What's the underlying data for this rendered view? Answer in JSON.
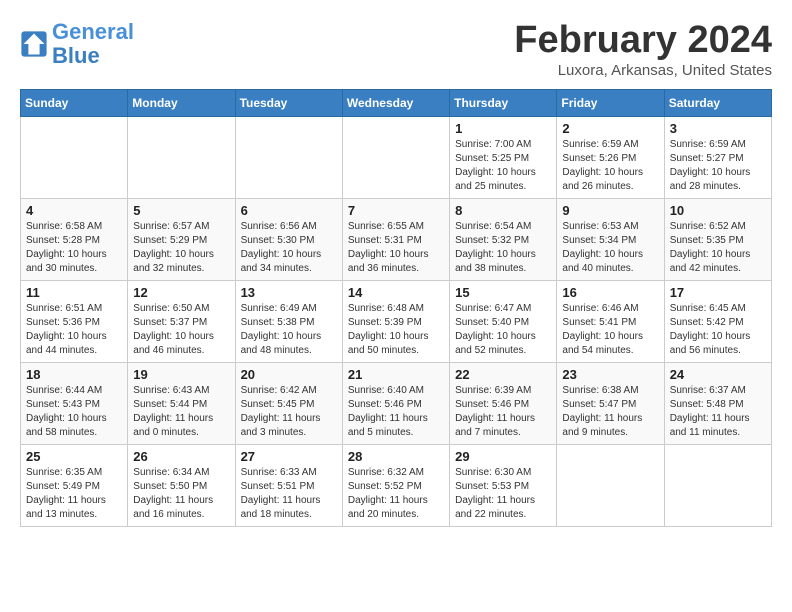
{
  "logo": {
    "general": "General",
    "blue": "Blue"
  },
  "title": "February 2024",
  "subtitle": "Luxora, Arkansas, United States",
  "days_of_week": [
    "Sunday",
    "Monday",
    "Tuesday",
    "Wednesday",
    "Thursday",
    "Friday",
    "Saturday"
  ],
  "weeks": [
    [
      {
        "day": "",
        "sunrise": "",
        "sunset": "",
        "daylight": ""
      },
      {
        "day": "",
        "sunrise": "",
        "sunset": "",
        "daylight": ""
      },
      {
        "day": "",
        "sunrise": "",
        "sunset": "",
        "daylight": ""
      },
      {
        "day": "",
        "sunrise": "",
        "sunset": "",
        "daylight": ""
      },
      {
        "day": "1",
        "sunrise": "Sunrise: 7:00 AM",
        "sunset": "Sunset: 5:25 PM",
        "daylight": "Daylight: 10 hours and 25 minutes."
      },
      {
        "day": "2",
        "sunrise": "Sunrise: 6:59 AM",
        "sunset": "Sunset: 5:26 PM",
        "daylight": "Daylight: 10 hours and 26 minutes."
      },
      {
        "day": "3",
        "sunrise": "Sunrise: 6:59 AM",
        "sunset": "Sunset: 5:27 PM",
        "daylight": "Daylight: 10 hours and 28 minutes."
      }
    ],
    [
      {
        "day": "4",
        "sunrise": "Sunrise: 6:58 AM",
        "sunset": "Sunset: 5:28 PM",
        "daylight": "Daylight: 10 hours and 30 minutes."
      },
      {
        "day": "5",
        "sunrise": "Sunrise: 6:57 AM",
        "sunset": "Sunset: 5:29 PM",
        "daylight": "Daylight: 10 hours and 32 minutes."
      },
      {
        "day": "6",
        "sunrise": "Sunrise: 6:56 AM",
        "sunset": "Sunset: 5:30 PM",
        "daylight": "Daylight: 10 hours and 34 minutes."
      },
      {
        "day": "7",
        "sunrise": "Sunrise: 6:55 AM",
        "sunset": "Sunset: 5:31 PM",
        "daylight": "Daylight: 10 hours and 36 minutes."
      },
      {
        "day": "8",
        "sunrise": "Sunrise: 6:54 AM",
        "sunset": "Sunset: 5:32 PM",
        "daylight": "Daylight: 10 hours and 38 minutes."
      },
      {
        "day": "9",
        "sunrise": "Sunrise: 6:53 AM",
        "sunset": "Sunset: 5:34 PM",
        "daylight": "Daylight: 10 hours and 40 minutes."
      },
      {
        "day": "10",
        "sunrise": "Sunrise: 6:52 AM",
        "sunset": "Sunset: 5:35 PM",
        "daylight": "Daylight: 10 hours and 42 minutes."
      }
    ],
    [
      {
        "day": "11",
        "sunrise": "Sunrise: 6:51 AM",
        "sunset": "Sunset: 5:36 PM",
        "daylight": "Daylight: 10 hours and 44 minutes."
      },
      {
        "day": "12",
        "sunrise": "Sunrise: 6:50 AM",
        "sunset": "Sunset: 5:37 PM",
        "daylight": "Daylight: 10 hours and 46 minutes."
      },
      {
        "day": "13",
        "sunrise": "Sunrise: 6:49 AM",
        "sunset": "Sunset: 5:38 PM",
        "daylight": "Daylight: 10 hours and 48 minutes."
      },
      {
        "day": "14",
        "sunrise": "Sunrise: 6:48 AM",
        "sunset": "Sunset: 5:39 PM",
        "daylight": "Daylight: 10 hours and 50 minutes."
      },
      {
        "day": "15",
        "sunrise": "Sunrise: 6:47 AM",
        "sunset": "Sunset: 5:40 PM",
        "daylight": "Daylight: 10 hours and 52 minutes."
      },
      {
        "day": "16",
        "sunrise": "Sunrise: 6:46 AM",
        "sunset": "Sunset: 5:41 PM",
        "daylight": "Daylight: 10 hours and 54 minutes."
      },
      {
        "day": "17",
        "sunrise": "Sunrise: 6:45 AM",
        "sunset": "Sunset: 5:42 PM",
        "daylight": "Daylight: 10 hours and 56 minutes."
      }
    ],
    [
      {
        "day": "18",
        "sunrise": "Sunrise: 6:44 AM",
        "sunset": "Sunset: 5:43 PM",
        "daylight": "Daylight: 10 hours and 58 minutes."
      },
      {
        "day": "19",
        "sunrise": "Sunrise: 6:43 AM",
        "sunset": "Sunset: 5:44 PM",
        "daylight": "Daylight: 11 hours and 0 minutes."
      },
      {
        "day": "20",
        "sunrise": "Sunrise: 6:42 AM",
        "sunset": "Sunset: 5:45 PM",
        "daylight": "Daylight: 11 hours and 3 minutes."
      },
      {
        "day": "21",
        "sunrise": "Sunrise: 6:40 AM",
        "sunset": "Sunset: 5:46 PM",
        "daylight": "Daylight: 11 hours and 5 minutes."
      },
      {
        "day": "22",
        "sunrise": "Sunrise: 6:39 AM",
        "sunset": "Sunset: 5:46 PM",
        "daylight": "Daylight: 11 hours and 7 minutes."
      },
      {
        "day": "23",
        "sunrise": "Sunrise: 6:38 AM",
        "sunset": "Sunset: 5:47 PM",
        "daylight": "Daylight: 11 hours and 9 minutes."
      },
      {
        "day": "24",
        "sunrise": "Sunrise: 6:37 AM",
        "sunset": "Sunset: 5:48 PM",
        "daylight": "Daylight: 11 hours and 11 minutes."
      }
    ],
    [
      {
        "day": "25",
        "sunrise": "Sunrise: 6:35 AM",
        "sunset": "Sunset: 5:49 PM",
        "daylight": "Daylight: 11 hours and 13 minutes."
      },
      {
        "day": "26",
        "sunrise": "Sunrise: 6:34 AM",
        "sunset": "Sunset: 5:50 PM",
        "daylight": "Daylight: 11 hours and 16 minutes."
      },
      {
        "day": "27",
        "sunrise": "Sunrise: 6:33 AM",
        "sunset": "Sunset: 5:51 PM",
        "daylight": "Daylight: 11 hours and 18 minutes."
      },
      {
        "day": "28",
        "sunrise": "Sunrise: 6:32 AM",
        "sunset": "Sunset: 5:52 PM",
        "daylight": "Daylight: 11 hours and 20 minutes."
      },
      {
        "day": "29",
        "sunrise": "Sunrise: 6:30 AM",
        "sunset": "Sunset: 5:53 PM",
        "daylight": "Daylight: 11 hours and 22 minutes."
      },
      {
        "day": "",
        "sunrise": "",
        "sunset": "",
        "daylight": ""
      },
      {
        "day": "",
        "sunrise": "",
        "sunset": "",
        "daylight": ""
      }
    ]
  ]
}
